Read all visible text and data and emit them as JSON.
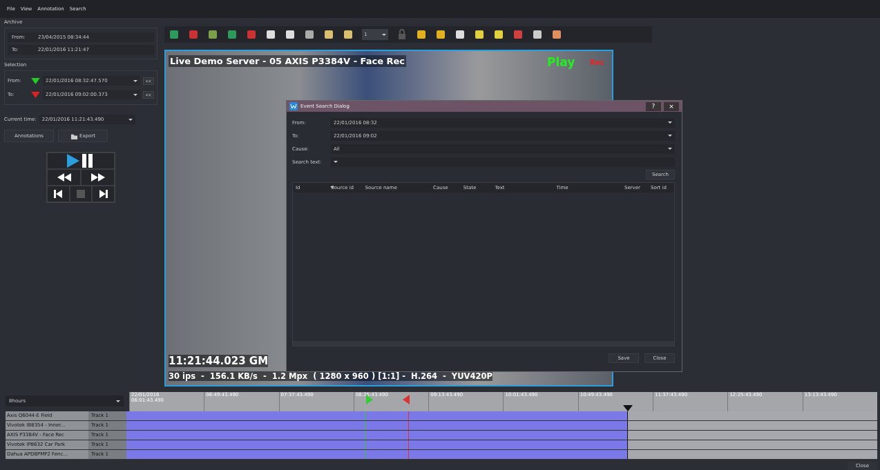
{
  "menu": [
    "File",
    "View",
    "Annotation",
    "Search"
  ],
  "archive": {
    "title": "Archive",
    "from_label": "From:",
    "from": "23/04/2015 08:34:44",
    "to_label": "To:",
    "to": "22/01/2016 11:21:47"
  },
  "selection": {
    "title": "Selection",
    "rows": [
      {
        "label": "From:",
        "value": "22/01/2016 08:32:47.570",
        "color": "#22cc22",
        "back": "<<"
      },
      {
        "label": "To:",
        "value": "22/01/2016 09:02:00.373",
        "color": "#dd2222",
        "back": "<<"
      }
    ]
  },
  "current_time": {
    "label": "Current time:",
    "value": "22/01/2016 11:21:43.490"
  },
  "buttons": [
    "Annotations",
    "Export"
  ],
  "playback": {
    "stop_disabled": true
  },
  "toolbar": {
    "count": "1"
  },
  "video": {
    "title": "Live Demo Server - 05 AXIS P3384V - Face Rec",
    "play": "Play",
    "rec": "Rec",
    "time": "11:21:44.023 GM",
    "stats": "30 ips  -  156.1 KB/s  -  1.2 Mpx  ( 1280 x 960 ) [1:1] -  H.264  -  YUV420P"
  },
  "dialog": {
    "title": "Event Search Dialog",
    "help": "?",
    "close": "×",
    "fields": [
      {
        "label": "From:",
        "value": "22/01/2016 08:32"
      },
      {
        "label": "To:",
        "value": "22/01/2016 09:02"
      },
      {
        "label": "Cause:",
        "value": "All"
      },
      {
        "label": "Search text:"
      }
    ],
    "search_button": "Search",
    "columns": [
      "Id",
      "Source id",
      "Source name",
      "Cause",
      "State",
      "Text",
      "Time",
      "Server",
      "Sort id"
    ],
    "buttons": [
      "Save",
      "Close"
    ]
  },
  "timeline": {
    "range": "8hours",
    "start_date": "22/01/2016",
    "ticks": [
      "06:01:43.490",
      "06:49:43.490",
      "07:37:43.490",
      "08:25:43.490",
      "09:13:43.490",
      "10:01:43.490",
      "10:49:43.490",
      "11:37:43.490",
      "12:25:43.490",
      "13:13:43.490"
    ],
    "selection_start": {
      "level": 0.317
    },
    "selection_end": {
      "level": 0.375
    },
    "recorded": {
      "level": 0.667
    },
    "tracks": [
      {
        "name": "Axis Q6044-E Field",
        "track": "Track 1"
      },
      {
        "name": "Vivotek IB8354 - Inner...",
        "track": "Track 1"
      },
      {
        "name": "AXIS P3384V - Face Rec",
        "track": "Track 1"
      },
      {
        "name": "Vivotek IP8632 Car Park",
        "track": "Track 1"
      },
      {
        "name": "Dahua APD8PMP2 Fenc...",
        "track": "Track 1"
      }
    ]
  },
  "footer_button": "Close"
}
